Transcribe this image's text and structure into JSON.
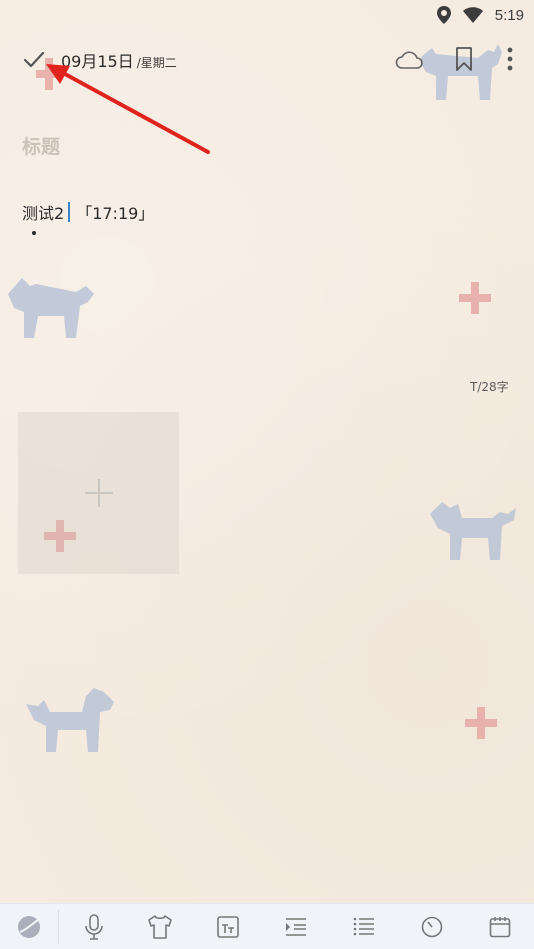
{
  "status_bar": {
    "time": "5:19",
    "icons": [
      "location-icon",
      "wifi-icon"
    ]
  },
  "header": {
    "date": "09月15日",
    "weekday": "/星期二",
    "icons": [
      "check-icon",
      "cloud-icon",
      "bookmark-icon",
      "more-vert-icon"
    ]
  },
  "editor": {
    "title_placeholder": "标题",
    "content_text": "测试2",
    "timestamp_tag": "「17:19」",
    "word_count": "T/28字"
  },
  "add_image": {
    "icon": "plus-icon"
  },
  "bottom_toolbar": {
    "items": [
      "theme-icon",
      "microphone-icon",
      "shirt-icon",
      "text-format-icon",
      "indent-icon",
      "list-icon",
      "timer-icon",
      "calendar-icon"
    ]
  },
  "colors": {
    "background": "#f5ebe0",
    "accent_caret": "#3a86c8",
    "annotation_arrow": "#e0231c",
    "decor_dog": "#b9c3d6",
    "decor_plus": "#e6a7a3"
  }
}
